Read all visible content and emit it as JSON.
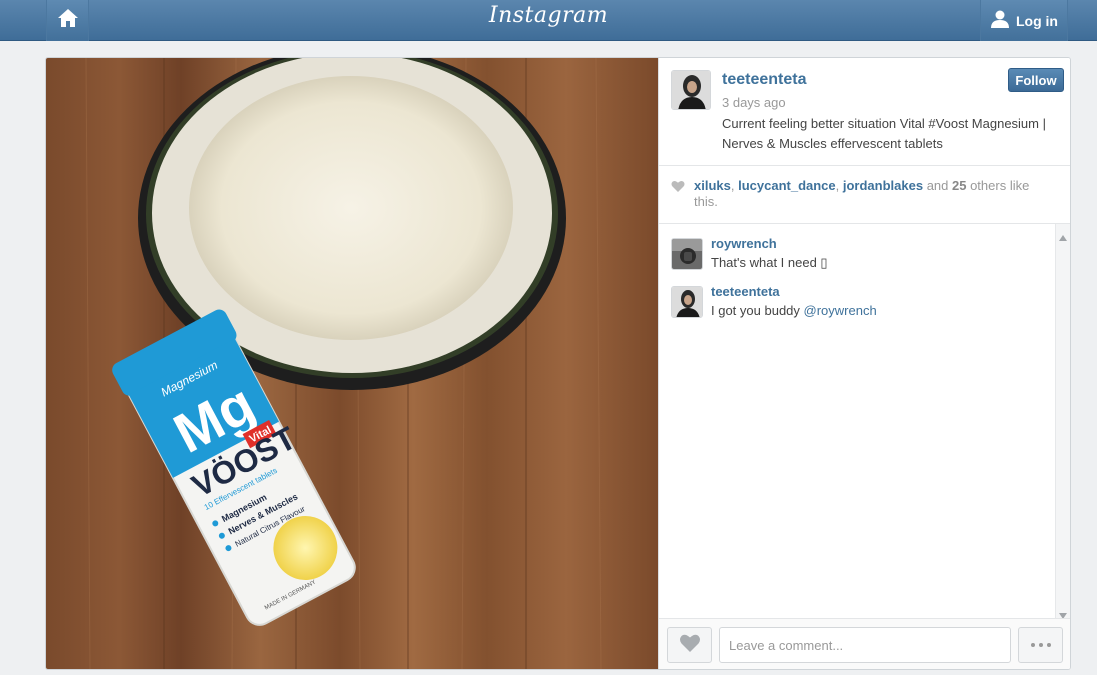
{
  "header": {
    "logo_text": "Instagram",
    "login_label": "Log in"
  },
  "post": {
    "owner": {
      "username": "teeteenteta",
      "time_ago": "3 days ago",
      "caption": "Current feeling better situation Vital #Voost Magnesium | Nerves & Muscles effervescent tablets",
      "follow_label": "Follow"
    },
    "photo": {
      "tube_brand": "VÖOST",
      "tube_mineral_name": "Magnesium",
      "tube_symbol": "Mg",
      "tube_badge": "Vital",
      "tube_subtitle": "10 Effervescent tablets",
      "tube_features": [
        "Magnesium",
        "Nerves & Muscles",
        "Natural Citrus Flavour"
      ],
      "tube_origin": "MADE IN GERMANY"
    },
    "likes": {
      "users": [
        "xiluks",
        "lucycant_dance",
        "jordanblakes"
      ],
      "separator": ", ",
      "and_text": " and ",
      "others_count": "25",
      "others_suffix": " others like this."
    },
    "comments": [
      {
        "username": "roywrench",
        "text": "That's what I need ▯",
        "mention": ""
      },
      {
        "username": "teeteenteta",
        "text": "I got you buddy ",
        "mention": "@roywrench"
      }
    ],
    "comment_placeholder": "Leave a comment..."
  },
  "colors": {
    "brand_blue": "#3f729b",
    "header_blue": "#4a77a2",
    "tube_blue": "#1f9ad6"
  }
}
